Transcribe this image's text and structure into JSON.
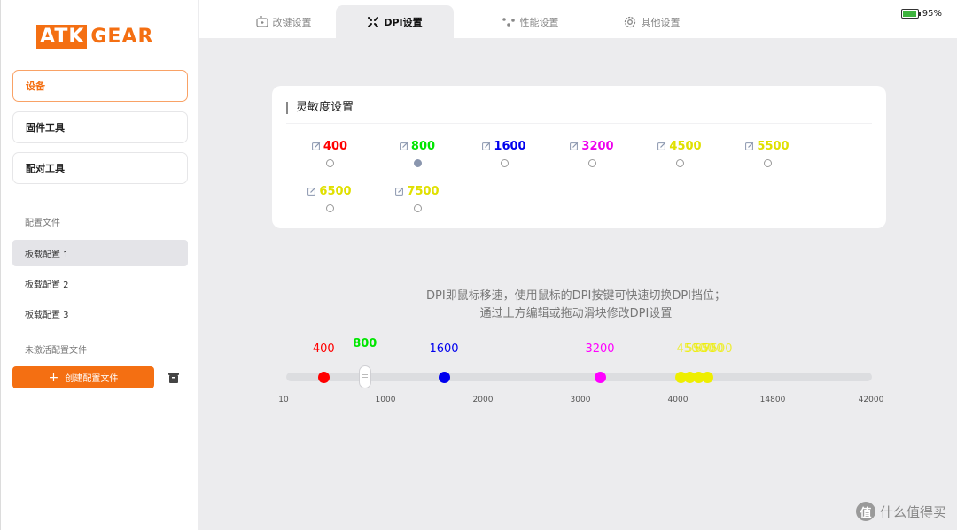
{
  "sidebar": {
    "logo_box": "ATK",
    "logo_text": "GEAR",
    "nav": [
      {
        "label": "设备"
      },
      {
        "label": "固件工具"
      },
      {
        "label": "配对工具"
      }
    ],
    "config_section": "配置文件",
    "configs": [
      {
        "label": "板载配置 1"
      },
      {
        "label": "板载配置 2"
      },
      {
        "label": "板载配置 3"
      }
    ],
    "inactive_section": "未激活配置文件",
    "create_label": "创建配置文件"
  },
  "tabs": [
    {
      "label": "改键设置",
      "icon": "keyboard-icon"
    },
    {
      "label": "DPI设置",
      "icon": "crosshair-icon"
    },
    {
      "label": "性能设置",
      "icon": "dots-icon"
    },
    {
      "label": "其他设置",
      "icon": "gear-icon"
    }
  ],
  "battery": {
    "level": 0.95,
    "text": "95%"
  },
  "sensitivity": {
    "title": "灵敏度设置",
    "options": [
      {
        "value": "400",
        "color": "#ff0000",
        "selected": false
      },
      {
        "value": "800",
        "color": "#00e600",
        "selected": true
      },
      {
        "value": "1600",
        "color": "#0000ee",
        "selected": false
      },
      {
        "value": "3200",
        "color": "#ee00ee",
        "selected": false
      },
      {
        "value": "4500",
        "color": "#e0e000",
        "selected": false
      },
      {
        "value": "5500",
        "color": "#e0e000",
        "selected": false
      },
      {
        "value": "6500",
        "color": "#e0e000",
        "selected": false
      },
      {
        "value": "7500",
        "color": "#e0e000",
        "selected": false
      }
    ]
  },
  "description": {
    "line1": "DPI即鼠标移速，使用鼠标的DPI按键可快速切换DPI挡位；",
    "line2": "通过上方编辑或拖动滑块修改DPI设置"
  },
  "slider": {
    "ticks": [
      "10",
      "1000",
      "2000",
      "3000",
      "4000",
      "14800",
      "42000"
    ],
    "points": [
      {
        "value": "400",
        "color": "#ff0000"
      },
      {
        "value": "800",
        "color": "#00e600",
        "handle": true
      },
      {
        "value": "1600",
        "color": "#0000ee"
      },
      {
        "value": "3200",
        "color": "#ff00ff"
      },
      {
        "value": "4500",
        "color": "#eeee00"
      },
      {
        "value": "5500",
        "color": "#eeee00"
      },
      {
        "value": "6500",
        "color": "#eeee00"
      },
      {
        "value": "7500",
        "color": "#eeee00"
      }
    ]
  },
  "watermark": {
    "icon": "值",
    "text": "什么值得买"
  }
}
